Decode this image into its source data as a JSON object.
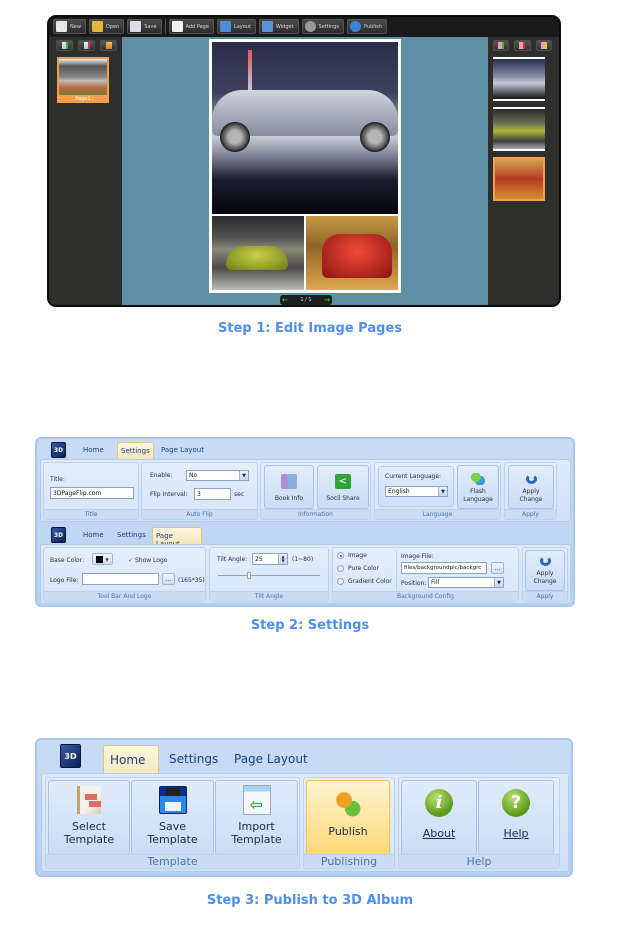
{
  "step1": {
    "caption": "Step 1: Edit Image Pages",
    "toolbar": [
      {
        "label": "New",
        "icon": "new-file-icon",
        "color": "#e8e8e8"
      },
      {
        "label": "Open",
        "icon": "open-folder-icon",
        "color": "#e3b53d"
      },
      {
        "label": "Save",
        "icon": "save-icon",
        "color": "#d9dde6"
      },
      {
        "label": "Add Page",
        "icon": "add-page-icon",
        "color": "#f2f2f2"
      },
      {
        "label": "Layout",
        "icon": "layout-icon",
        "color": "#4a8fd6"
      },
      {
        "label": "Widget",
        "icon": "widget-icon",
        "color": "#5a92d8"
      },
      {
        "label": "Settings",
        "icon": "gear-icon",
        "color": "#9a9a9a"
      },
      {
        "label": "Publish",
        "icon": "globe-icon",
        "color": "#3a86d8"
      }
    ],
    "left_tools": [
      "add-page-icon",
      "delete-page-icon",
      "page-properties-icon"
    ],
    "right_tools": [
      "add-image-icon",
      "delete-image-icon",
      "image-properties-icon"
    ],
    "page_thumbnail_label": "Page1",
    "pager": {
      "current": "1",
      "total": "1",
      "text": "1 / 1"
    },
    "images": [
      "silver-mini-car",
      "green-sports-car",
      "red-mini-car"
    ]
  },
  "step2": {
    "caption": "Step 2: Settings",
    "ribbon1": {
      "logo": "3D",
      "tabs": [
        "Home",
        "Settings",
        "Page Layout"
      ],
      "active_tab": "Settings",
      "title_label": "Title:",
      "title_value": "3DPageFlip.com",
      "title_group": "Title",
      "enable_label": "Enable:",
      "enable_value": "No",
      "interval_label": "Flip Interval:",
      "interval_value": "3",
      "interval_unit": "sec",
      "autoflip_group": "Auto Flip",
      "book_info": "Book Info",
      "social_share": "Socil Share",
      "information_group": "Information",
      "language_label": "Current Language:",
      "language_value": "English",
      "flash_language": "Flash Language",
      "language_group": "Language",
      "apply_change": "Apply Change",
      "apply_group": "Apply"
    },
    "ribbon2": {
      "logo": "3D",
      "tabs": [
        "Home",
        "Settings",
        "Page Layout"
      ],
      "active_tab": "Page Layout",
      "base_color_label": "Base Color:",
      "base_color_value": "#000000",
      "show_logo_label": "Show Logo",
      "show_logo_checked": true,
      "logo_file_label": "Logo File:",
      "logo_file_value": "",
      "browse": "...",
      "logo_size_hint": "(165*35)",
      "toolbar_group": "Tool Bar And Logo",
      "tilt_label": "Tilt Angle:",
      "tilt_value": "25",
      "tilt_range": "(1~80)",
      "tilt_group": "Tilt Angle",
      "bg_options": [
        "Image",
        "Pure Color",
        "Gradient Color"
      ],
      "bg_selected": "Image",
      "image_file_label": "Image File:",
      "image_file_value": "files/backgroundpic/backgrc",
      "position_label": "Position:",
      "position_value": "Fill",
      "bg_group": "Background Config",
      "apply_change": "Apply Change",
      "apply_group": "Apply"
    }
  },
  "step3": {
    "caption": "Step 3: Publish to 3D Album",
    "logo": "3D",
    "tabs": [
      "Home",
      "Settings",
      "Page Layout"
    ],
    "active_tab": "Home",
    "template_buttons": [
      {
        "line1": "Select",
        "line2": "Template"
      },
      {
        "line1": "Save",
        "line2": "Template"
      },
      {
        "line1": "Import",
        "line2": "Template"
      }
    ],
    "template_group": "Template",
    "publish": "Publish",
    "publishing_group": "Publishing",
    "about": "About",
    "help": "Help",
    "help_group": "Help"
  }
}
